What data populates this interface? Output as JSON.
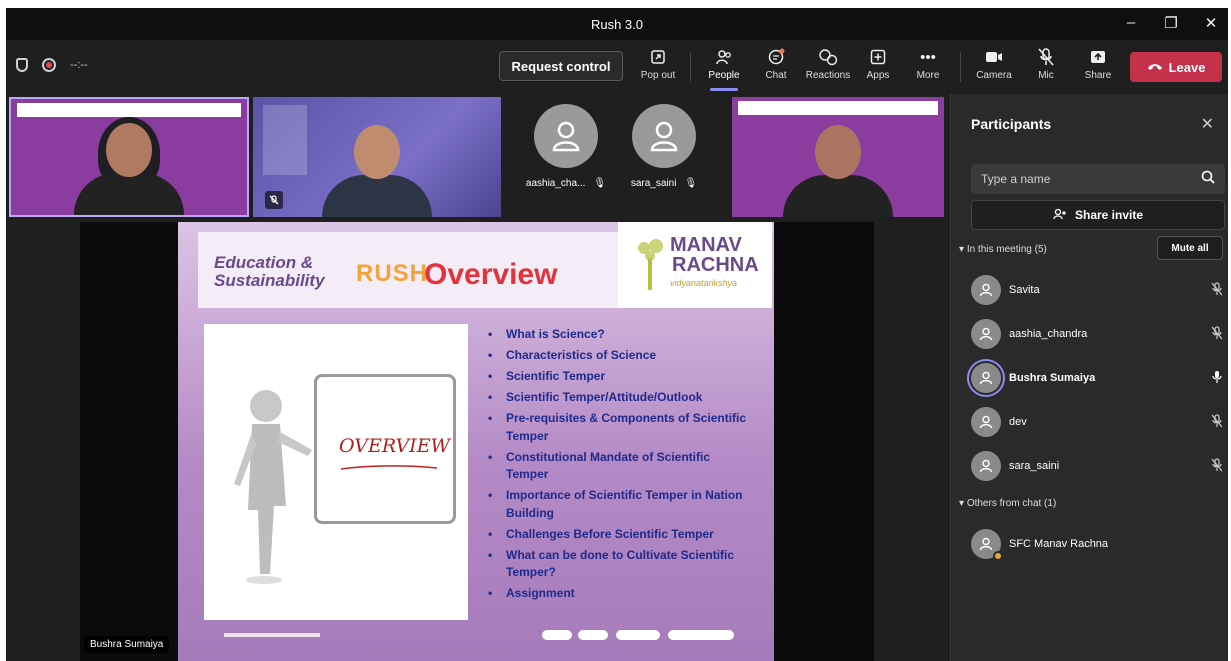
{
  "window": {
    "title": "Rush 3.0",
    "controls": {
      "minimize": "–",
      "maximize": "❐",
      "close": "✕"
    }
  },
  "toolbar": {
    "timer": "--:--",
    "request_control": "Request control",
    "items": [
      {
        "label": "Pop out",
        "icon": "popout-icon"
      },
      {
        "label": "People",
        "icon": "people-icon"
      },
      {
        "label": "Chat",
        "icon": "chat-icon"
      },
      {
        "label": "Reactions",
        "icon": "reactions-icon"
      },
      {
        "label": "Apps",
        "icon": "apps-icon"
      },
      {
        "label": "More",
        "icon": "more-icon"
      },
      {
        "label": "Camera",
        "icon": "camera-icon"
      },
      {
        "label": "Mic",
        "icon": "mic-off-icon"
      },
      {
        "label": "Share",
        "icon": "share-icon"
      }
    ],
    "leave": "Leave",
    "accent": "#c4314b"
  },
  "video_tiles": [
    {
      "name": "aashia_cha...",
      "muted": true
    },
    {
      "name": "sara_saini",
      "muted": true
    }
  ],
  "slide": {
    "education": "Education &",
    "sustainability": "Sustainability",
    "rush": "RUSH",
    "title": "Overview",
    "logo_line1": "MANAV",
    "logo_line2": "RACHNA",
    "logo_sub": "vidyanatarikshya",
    "board_text": "OVERVIEW",
    "bullets": [
      "What is Science?",
      "Characteristics of Science",
      "Scientific Temper",
      "Scientific Temper/Attitude/Outlook",
      "Pre-requisites & Components of Scientific Temper",
      "Constitutional Mandate of Scientific Temper",
      "Importance of Scientific Temper in Nation Building",
      "Challenges Before Scientific Temper",
      "What can be done to Cultivate Scientific Temper?",
      "Assignment"
    ]
  },
  "presenter_name": "Bushra Sumaiya",
  "panel": {
    "title": "Participants",
    "search_placeholder": "Type a name",
    "share_invite": "Share invite",
    "in_meeting_header": "In this meeting (5)",
    "mute_all": "Mute all",
    "participants": [
      {
        "name": "Savita",
        "speaking": false,
        "bold": false
      },
      {
        "name": "aashia_chandra",
        "speaking": false,
        "bold": false
      },
      {
        "name": "Bushra Sumaiya",
        "speaking": true,
        "bold": true
      },
      {
        "name": "dev",
        "speaking": false,
        "bold": false
      },
      {
        "name": "sara_saini",
        "speaking": false,
        "bold": false
      }
    ],
    "others_header": "Others from chat (1)",
    "others": [
      {
        "name": "SFC Manav Rachna"
      }
    ]
  }
}
